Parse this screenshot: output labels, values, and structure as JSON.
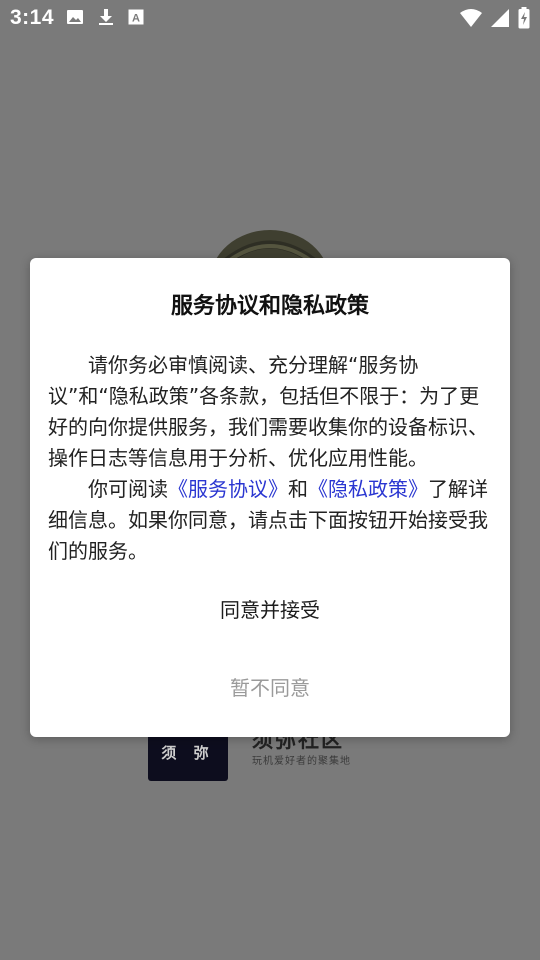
{
  "status_bar": {
    "time": "3:14",
    "icons_left": [
      "image-icon",
      "download-icon",
      "text-icon"
    ],
    "icons_right": [
      "wifi-icon",
      "signal-icon",
      "battery-charging-icon"
    ]
  },
  "background": {
    "brand_logo_text": "须 弥",
    "brand_name": "须弥社区",
    "brand_tagline": "玩机爱好者的聚集地"
  },
  "dialog": {
    "title": "服务协议和隐私政策",
    "para1": "请你务必审慎阅读、充分理解“服务协议”和“隐私政策”各条款，包括但不限于：为了更好的向你提供服务，我们需要收集你的设备标识、操作日志等信息用于分析、优化应用性能。",
    "para2_prefix": "你可阅读",
    "link_service": "《服务协议》",
    "para2_and": "和",
    "link_privacy": "《隐私政策》",
    "para2_suffix": "了解详细信息。如果你同意，请点击下面按钮开始接受我们的服务。",
    "agree_label": "同意并接受",
    "decline_label": "暂不同意"
  },
  "colors": {
    "overlay": "#7a7a7a",
    "link": "#2a36d1",
    "decline_text": "#9a9a9a"
  }
}
